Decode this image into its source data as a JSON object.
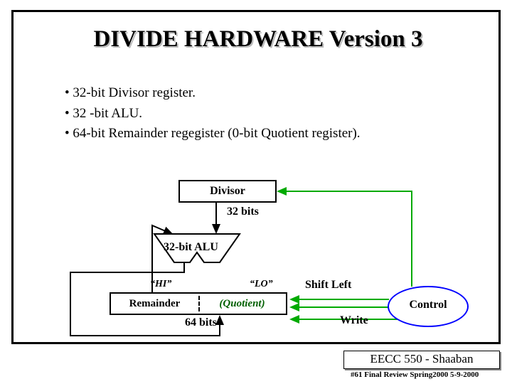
{
  "title": "DIVIDE HARDWARE Version 3",
  "bullets": {
    "b1": "32-bit Divisor register.",
    "b2": "32 -bit ALU.",
    "b3": "64-bit Remainder regegister (0-bit Quotient register)."
  },
  "diagram": {
    "divisor": "Divisor",
    "divisor_bits": "32 bits",
    "alu": "32-bit ALU",
    "hi": "“HI”",
    "lo": "“LO”",
    "remainder": "Remainder",
    "quotient": "(Quotient)",
    "bits64": "64 bits",
    "shift": "Shift Left",
    "write": "Write",
    "control": "Control"
  },
  "footer": {
    "course": "EECC 550 - Shaaban",
    "slide": "#61   Final Review   Spring2000  5-9-2000"
  }
}
